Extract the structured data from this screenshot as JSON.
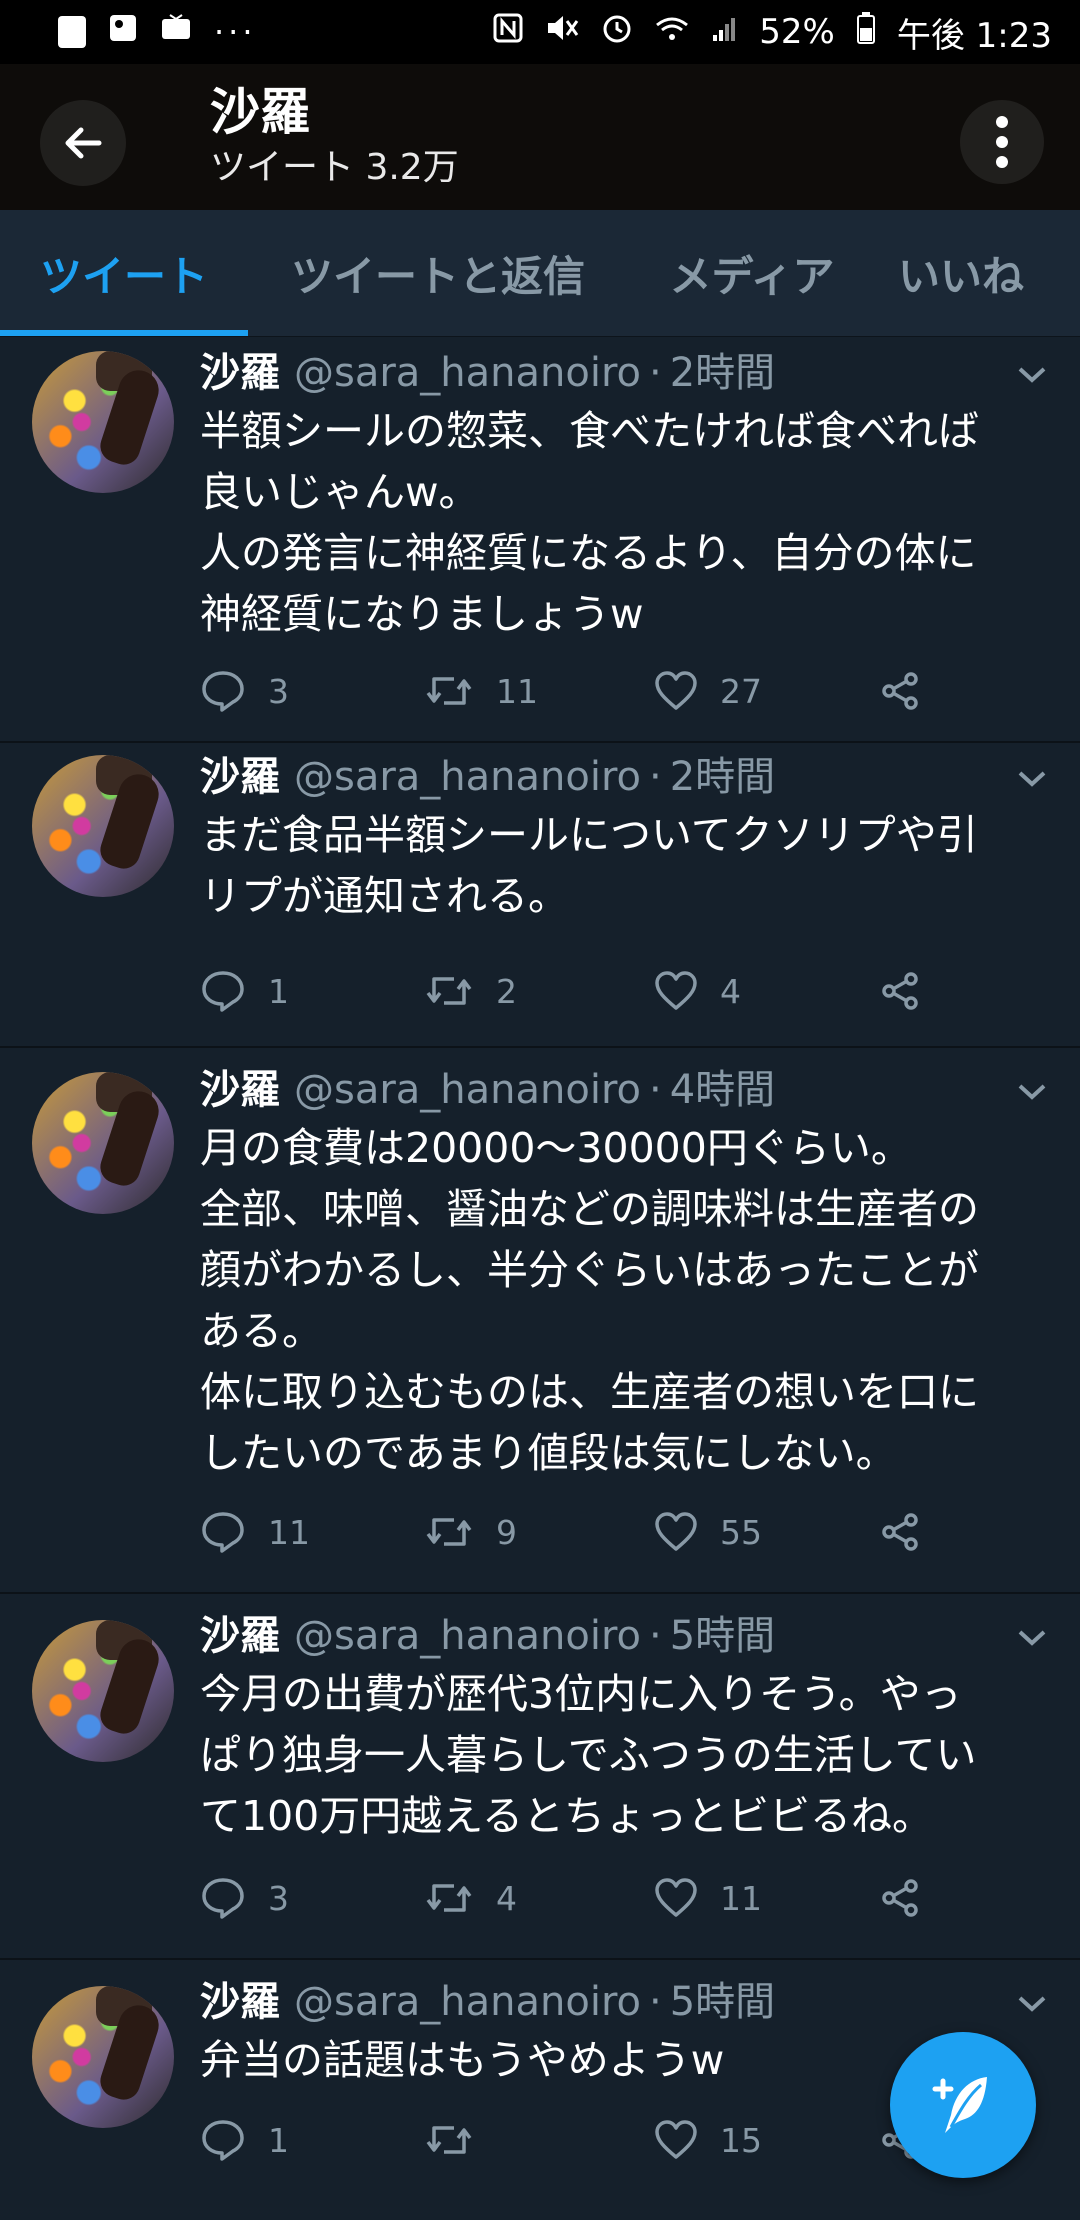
{
  "status_bar": {
    "battery": "52%",
    "time": "午後 1:23",
    "dots": "···"
  },
  "header": {
    "title": "沙羅",
    "subtitle": "ツイート 3.2万"
  },
  "tabs": [
    {
      "label": "ツイート",
      "active": true
    },
    {
      "label": "ツイートと返信",
      "active": false
    },
    {
      "label": "メディア",
      "active": false
    },
    {
      "label": "いいね",
      "active": false
    }
  ],
  "tweets": [
    {
      "name": "沙羅",
      "handle": "@sara_hananoiro",
      "time": "2時間",
      "text": "半額シールの惣菜、食べたければ食べれば\n良いじゃんw。\n人の発言に神経質になるより、自分の体に\n神経質になりましょうw",
      "replies": "3",
      "retweets": "11",
      "likes": "27"
    },
    {
      "name": "沙羅",
      "handle": "@sara_hananoiro",
      "time": "2時間",
      "text": "まだ食品半額シールについてクソリプや引\nリプが通知される。",
      "replies": "1",
      "retweets": "2",
      "likes": "4"
    },
    {
      "name": "沙羅",
      "handle": "@sara_hananoiro",
      "time": "4時間",
      "text": "月の食費は20000〜30000円ぐらい。\n全部、味噌、醤油などの調味料は生産者の\n顔がわかるし、半分ぐらいはあったことが\nある。\n体に取り込むものは、生産者の想いを口に\nしたいのであまり値段は気にしない。",
      "replies": "11",
      "retweets": "9",
      "likes": "55"
    },
    {
      "name": "沙羅",
      "handle": "@sara_hananoiro",
      "time": "5時間",
      "text": "今月の出費が歴代3位内に入りそう。やっ\nぱり独身一人暮らしでふつうの生活してい\nて100万円越えるとちょっとビビるね。",
      "replies": "3",
      "retweets": "4",
      "likes": "11"
    },
    {
      "name": "沙羅",
      "handle": "@sara_hananoiro",
      "time": "5時間",
      "text": "弁当の話題はもうやめようw",
      "replies": "1",
      "retweets": "",
      "likes": "15"
    }
  ],
  "colors": {
    "background": "#15202b",
    "accent": "#1da1f2",
    "muted": "#8899a6"
  }
}
